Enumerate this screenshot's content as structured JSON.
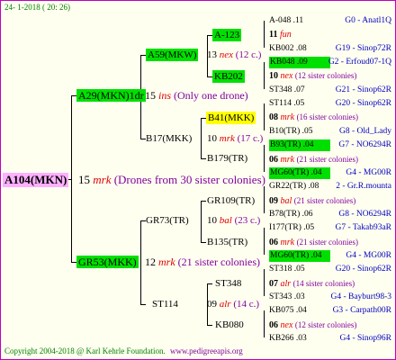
{
  "header": {
    "date": "24- 1-2018 ( 20: 26)"
  },
  "footer": {
    "copyright": "Copyright 2004-2018 @ Karl Kehrle Foundation.",
    "site": "www.pedigreeapis.org"
  },
  "root": {
    "id": "A104(MKN)",
    "num": "15",
    "code": "mrk",
    "note": "(Drones from 30 sister colonies)"
  },
  "gen1": {
    "top": {
      "id": "A29(MKN)1dr",
      "num": "15",
      "code": "ins",
      "note": "(Only one drone)"
    },
    "bottom": {
      "id": "GR53(MKK)",
      "num": "12",
      "code": "mrk",
      "note": "(21 sister colonies)"
    }
  },
  "gen2": {
    "a59": {
      "id": "A59(MKW)",
      "num": "13",
      "code": "nex",
      "note": "(12 c.)"
    },
    "b17": {
      "id": "B17(MKK)",
      "num": "10",
      "code": "mrk",
      "note": "(17 c.)"
    },
    "gr73": {
      "id": "GR73(TR)",
      "num": "10",
      "code": "bal",
      "note": "(23 c.)"
    },
    "st114": {
      "id": "ST114",
      "num": "09",
      "code": "alr",
      "note": "(14 c.)"
    }
  },
  "gen3": {
    "a123": {
      "id": "A-123"
    },
    "kb202": {
      "id": "KB202"
    },
    "b41": {
      "id": "B41(MKK)"
    },
    "b179": {
      "id": "B179(TR)"
    },
    "gr109": {
      "id": "GR109(TR)"
    },
    "b135": {
      "id": "B135(TR)"
    },
    "st348": {
      "id": "ST348"
    },
    "kb080": {
      "id": "KB080"
    }
  },
  "gen4": [
    {
      "left": "A-048 .11",
      "right": "G0 - Anatl1Q"
    },
    {
      "num": "11",
      "code": "fun",
      "note": ""
    },
    {
      "left": "KB002 .08",
      "right": "G19 - Sinop72R"
    },
    {
      "left": "KB048 .09",
      "right": "G2 - Erfoud07-1Q"
    },
    {
      "num": "10",
      "code": "nex",
      "note": "(12 sister colonies)"
    },
    {
      "left": "ST348 .07",
      "right": "G21 - Sinop62R"
    },
    {
      "left": "ST114 .05",
      "right": "G20 - Sinop62R"
    },
    {
      "num": "08",
      "code": "mrk",
      "note": "(16 sister colonies)"
    },
    {
      "left": "B10(TR) .05",
      "right": "G8 - Old_Lady"
    },
    {
      "left": "B93(TR) .04",
      "right": "G7 - NO6294R"
    },
    {
      "num": "06",
      "code": "mrk",
      "note": "(21 sister colonies)"
    },
    {
      "left": "MG60(TR) .04",
      "right": "G4 - MG00R"
    },
    {
      "left": "GR22(TR) .08",
      "right": "2 - Gr.R.mounta"
    },
    {
      "num": "09",
      "code": "bal",
      "note": "(21 sister colonies)"
    },
    {
      "left": "B78(TR) .06",
      "right": "G8 - NO6294R"
    },
    {
      "left": "I177(TR) .05",
      "right": "G7 - Takab93aR"
    },
    {
      "num": "06",
      "code": "mrk",
      "note": "(21 sister colonies)"
    },
    {
      "left": "MG60(TR) .04",
      "right": "G4 - MG00R"
    },
    {
      "left": "ST318 .05",
      "right": "G20 - Sinop62R"
    },
    {
      "num": "07",
      "code": "alr",
      "note": "(14 sister colonies)"
    },
    {
      "left": "ST343 .03",
      "right": "G4 - Bayburt98-3"
    },
    {
      "left": "KB075 .04",
      "right": "G3 - Carpath00R"
    },
    {
      "num": "06",
      "code": "nex",
      "note": "(12 sister colonies)"
    },
    {
      "left": "KB266 .03",
      "right": "G4 - Sinop96R"
    }
  ]
}
